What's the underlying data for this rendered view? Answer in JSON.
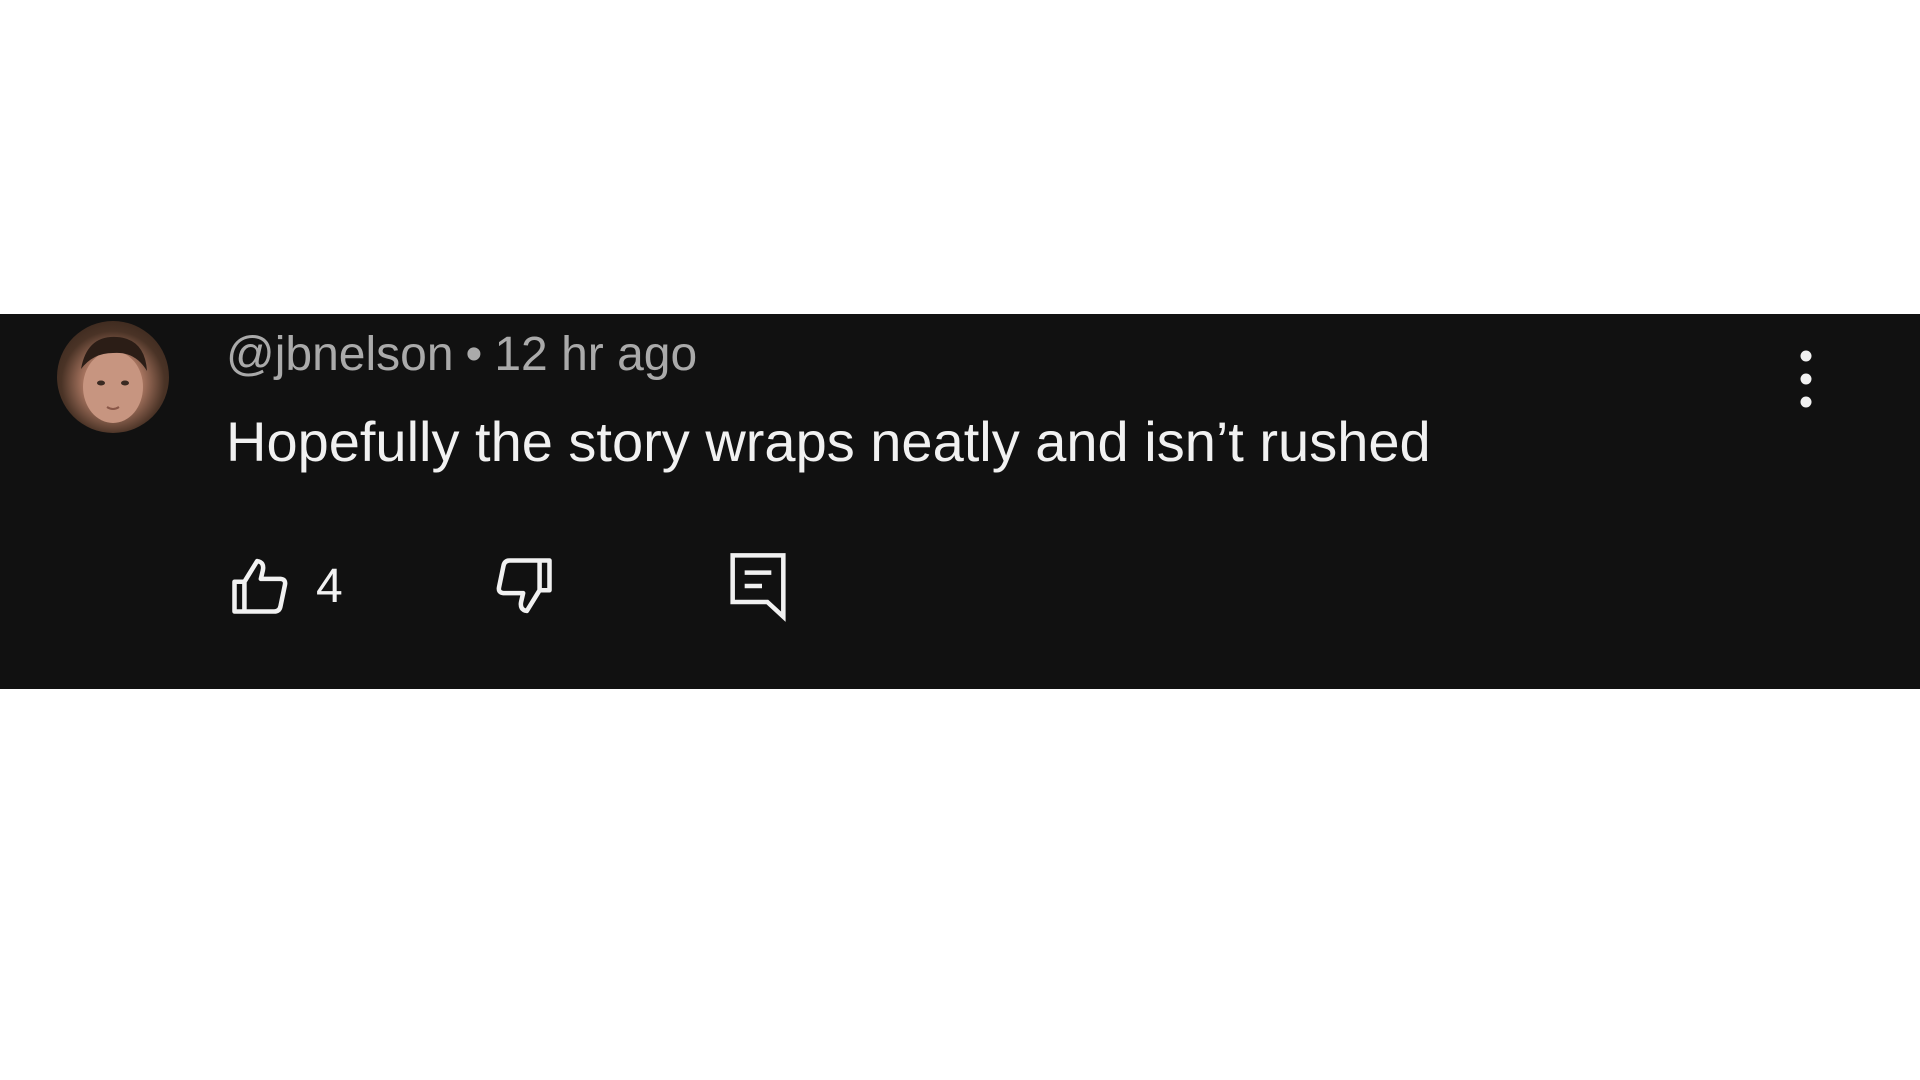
{
  "comment": {
    "author": "@jbnelson",
    "separator": "•",
    "timestamp": "12 hr ago",
    "text": "Hopefully the story wraps neatly and isn’t rushed",
    "like_count": "4"
  },
  "icons": {
    "like": "thumbs-up-icon",
    "dislike": "thumbs-down-icon",
    "reply": "reply-comment-icon",
    "more": "more-vertical-icon"
  },
  "colors": {
    "background": "#111111",
    "page": "#ffffff",
    "primary_text": "#f1f1f1",
    "secondary_text": "#aaaaaa"
  }
}
